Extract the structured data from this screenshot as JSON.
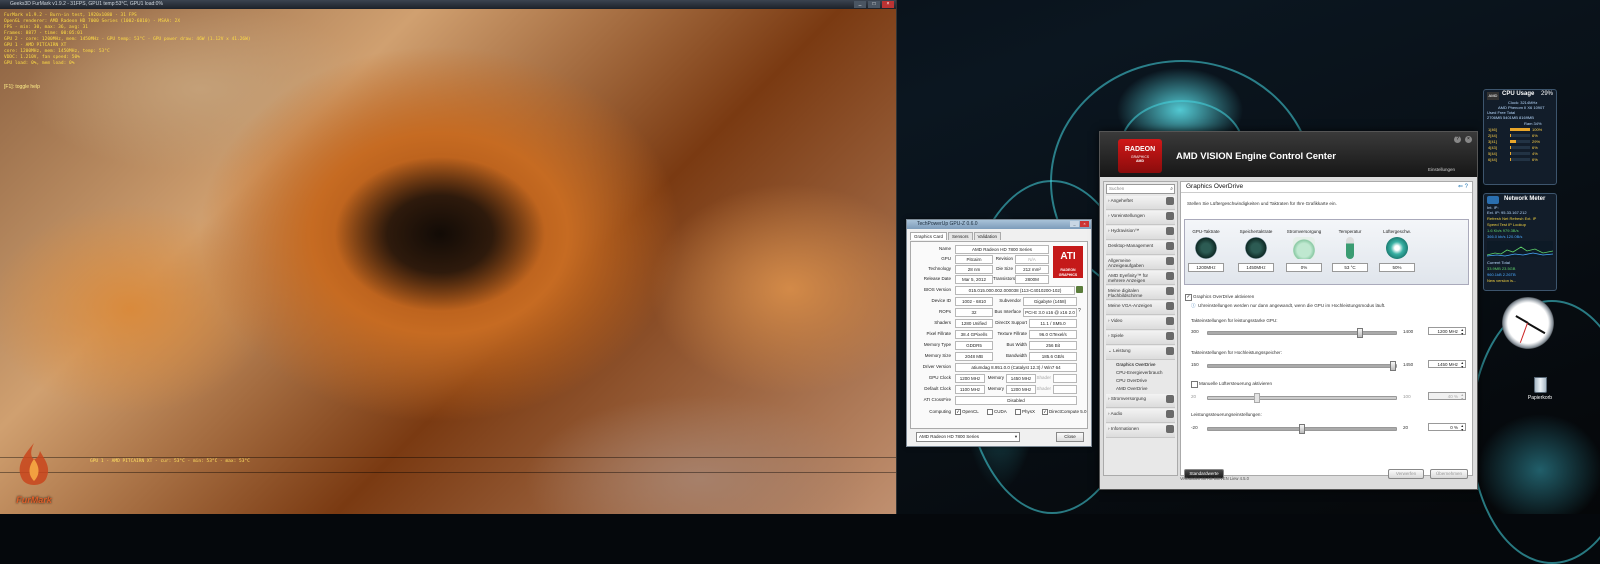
{
  "furmark": {
    "title": "Geeks3D FurMark v1.9.2 - 31FPS, GPU1 temp:53°C, GPU1 load:0%",
    "osd": [
      "FurMark v1.9.2 - Burn-in test, 1920x1080 - 31 FPS",
      "OpenGL renderer: AMD Radeon HD 7000 Series (1002-6810) - MSAA: 2X",
      "FPS - min: 30, max: 36, avg: 31",
      "Frames: 8877 - time: 00:05:01",
      "GPU 2 - core: 1200MHz, mem: 1450MHz - GPU temp: 53°C - GPU power draw: 46W (1.12V x 41.26W)",
      "GPU 1 - AMD PITCAIRN XT",
      "   core: 1200MHz, mem: 1450MHz, temp: 53°C",
      "   VDDC: 1.210V, fan speed: 50%",
      "   GPU load: 0%, mem load: 0%"
    ],
    "hint": "[F1]: toggle help",
    "graph_label": "GPU 1 - AMD PITCAIRN XT - cur: 53°C - min: 53°C - max: 53°C",
    "logo": "FurMark"
  },
  "gpuz": {
    "title": "TechPowerUp GPU-Z 0.6.0",
    "tabs": [
      "Graphics Card",
      "Sensors",
      "Validation"
    ],
    "logo_main": "ATI",
    "logo_sub": "RADEON GRAPHICS",
    "rows": {
      "name": {
        "label": "Name",
        "value": "AMD Radeon HD 7800 Series"
      },
      "gpu": {
        "label": "GPU",
        "value": "Pitcairn",
        "sublabel": "Revision",
        "subvalue": "N/A"
      },
      "tech": {
        "label": "Technology",
        "value": "28 nm",
        "sublabel": "Die Size",
        "subvalue": "212 mm²"
      },
      "release": {
        "label": "Release Date",
        "value": "Mar 5, 2012",
        "sublabel": "Transistors",
        "subvalue": "2800M"
      },
      "bios": {
        "label": "BIOS Version",
        "value": "015.015.000.002.000038 (113-C4010200-102)"
      },
      "device": {
        "label": "Device ID",
        "value": "1002 - 6810",
        "sublabel": "Subvendor",
        "subvalue": "Gigabyte (1458)"
      },
      "rops": {
        "label": "ROPs",
        "value": "32",
        "sublabel": "Bus Interface",
        "subvalue": "PCI-E 3.0 x16 @ x16 2.0"
      },
      "shaders": {
        "label": "Shaders",
        "value": "1280 Unified",
        "sublabel": "DirectX Support",
        "subvalue": "11.1 / SM5.0"
      },
      "pixel": {
        "label": "Pixel Fillrate",
        "value": "38.4 GPixel/s",
        "sublabel": "Texture Fillrate",
        "subvalue": "96.0 GTexel/s"
      },
      "memtype": {
        "label": "Memory Type",
        "value": "GDDR5",
        "sublabel": "Bus Width",
        "subvalue": "256 Bit"
      },
      "memsize": {
        "label": "Memory Size",
        "value": "2048 MB",
        "sublabel": "Bandwidth",
        "subvalue": "185.6 GB/s"
      },
      "driver": {
        "label": "Driver Version",
        "value": "atiumdag 8.951.0.0 (Catalyst 12.3) / Win7 64"
      },
      "gpuclock": {
        "label": "GPU Clock",
        "value": "1200 MHz",
        "mlabel": "Memory",
        "mvalue": "1450 MHz",
        "sublabel": "Shader",
        "subvalue": ""
      },
      "defclock": {
        "label": "Default Clock",
        "value": "1100 MHz",
        "mlabel": "Memory",
        "mvalue": "1200 MHz",
        "sublabel": "Shader",
        "subvalue": ""
      },
      "crossfire": {
        "label": "ATI CrossFire",
        "value": "Disabled"
      },
      "computing": {
        "label": "Computing",
        "opencl": "OpenCL",
        "cuda": "CUDA",
        "physx": "PhysX",
        "dc": "DirectCompute 5.0"
      }
    },
    "selected_card": "AMD Radeon HD 7800 Series",
    "close_label": "Close"
  },
  "amd": {
    "title": "AMD VISION Engine Control Center",
    "logo_main": "RADEON",
    "logo_sub": "GRAPHICS",
    "logo_brand": "AMD",
    "settings_label": "Einstellungen",
    "search_placeholder": "Suchen",
    "nav": [
      "Angeheftet",
      "Voreinstellungen",
      "Hydravision™",
      "Desktop-Management",
      "Allgemeine Anzeigeaufgaben",
      "AMD Eyefinity™ für mehrere Anzeigen",
      "Meine digitalen Flachbildschirme",
      "Meine VGA-Anzeigen",
      "Video",
      "Spiele",
      "Leistung"
    ],
    "nav_sub": [
      "Graphics OverDrive",
      "CPU-Energieverbrauch",
      "CPU OverDrive",
      "AMD OverDrive"
    ],
    "nav_after": [
      "Stromversorgung",
      "Audio",
      "Informationen"
    ],
    "main_title": "Graphics OverDrive",
    "main_desc": "Stellen Sie Lüftergeschwindigkeiten und Taktraten für Ihre Grafikkarte ein.",
    "gauges": [
      {
        "label": "GPU-Taktrate",
        "value": "1200MHz"
      },
      {
        "label": "Speichertaktrate",
        "value": "1450MHz"
      },
      {
        "label": "Stromversorgung",
        "value": "0%"
      },
      {
        "label": "Temperatur",
        "value": "53 °C"
      },
      {
        "label": "Lüftergeschw.",
        "value": "50%"
      }
    ],
    "enable_label": "Graphics OverDrive aktivieren",
    "info_text": "Uhreinstellungen werden nur dann angewandt, wenn die GPU im Hochleistungsmodus läuft.",
    "gpu_clock": {
      "label": "Takteinstellungen für leistungsstarke GPU:",
      "min": "300",
      "max": "1400",
      "value": "1200  MHz",
      "fraction": 0.82
    },
    "mem_clock": {
      "label": "Takteinstellungen für Hochleistungsspeicher:",
      "min": "150",
      "max": "1450",
      "value": "1450  MHz",
      "fraction": 1.0
    },
    "fan": {
      "label": "Manuelle Lüftersteuerung aktivieren",
      "min": "20",
      "max": "100",
      "value": "40  %",
      "fraction": 0.25
    },
    "power": {
      "label": "Leistungssteuerungseinstellungen:",
      "min": "-20",
      "max": "20",
      "value": "0  %",
      "fraction": 0.5
    },
    "default_label": "Standardwerte",
    "discard_label": "Verwerfen",
    "apply_label": "Übernehmen",
    "statusbar": "Verbunden an AS 0/EVEN Liew 4.5.0"
  },
  "cpu_gadget": {
    "title": "CPU Usage",
    "percent": "29%",
    "brand": "AMD",
    "clock": "Clock: 3214MHz",
    "model": "AMD Phenom II X6 1090T",
    "mem_header": "Used      Free      Total",
    "mem_values": "2706MB   5401MB   8169MB",
    "ram_label": "Ram      34%",
    "cores": [
      {
        "label": "1[46]",
        "value": "100%",
        "fill": 1.0
      },
      {
        "label": "2[44]",
        "value": "6%",
        "fill": 0.06
      },
      {
        "label": "3[41]",
        "value": "29%",
        "fill": 0.29
      },
      {
        "label": "4[43]",
        "value": "6%",
        "fill": 0.06
      },
      {
        "label": "5[44]",
        "value": "4%",
        "fill": 0.04
      },
      {
        "label": "6[44]",
        "value": "6%",
        "fill": 0.06
      }
    ]
  },
  "net_gadget": {
    "title": "Network Meter",
    "lines": [
      "Int. IP:",
      "Ext. IP: 95.33.167.212",
      "Refresh Net    Refresh Ext. IP",
      "Speed Test      IP Lookup",
      "1.6 Kb/s      979.3B/s",
      "366.0 kb/s    120.0B/s",
      "Current           Total",
      "33.9MB          23.5GB",
      "960.1kB         2.26TB",
      "New version is..."
    ]
  },
  "desktop": {
    "recycle_label": "Papierkorb"
  }
}
